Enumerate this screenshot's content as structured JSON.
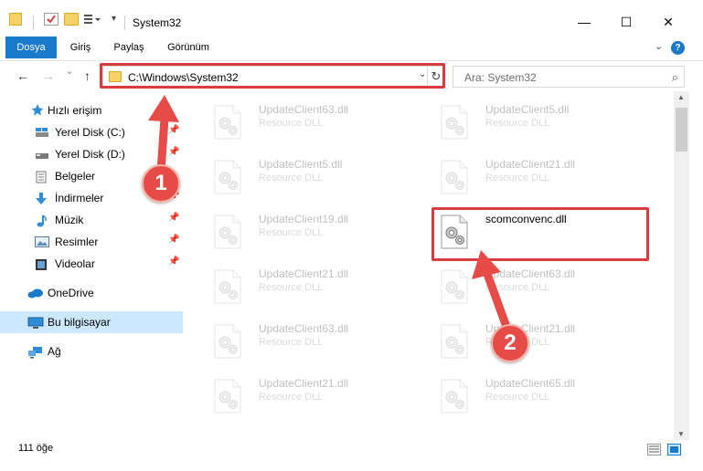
{
  "window": {
    "title": "System32",
    "minimize_symbol": "—",
    "maximize_symbol": "☐",
    "close_symbol": "✕"
  },
  "ribbon": {
    "tabs": [
      "Dosya",
      "Giriş",
      "Paylaş",
      "Görünüm"
    ],
    "expand_symbol": "⌄",
    "help_symbol": "?"
  },
  "navigation": {
    "back_symbol": "←",
    "forward_symbol": "→",
    "recent_symbol": "⌄",
    "up_symbol": "↑",
    "address": "C:\\Windows\\System32",
    "dropdown_symbol": "⌄",
    "refresh_symbol": "↻",
    "search_placeholder": "Ara: System32",
    "search_symbol": "⌕"
  },
  "sidebar": {
    "pin_symbol": "📌",
    "quick_access": {
      "label": "Hızlı erişim",
      "icon": "star-icon"
    },
    "items": [
      {
        "label": "Yerel Disk (C:)",
        "icon": "drive-icon",
        "pinned": true
      },
      {
        "label": "Yerel Disk (D:)",
        "icon": "drive-icon",
        "pinned": true
      },
      {
        "label": "Belgeler",
        "icon": "documents-icon",
        "pinned": true
      },
      {
        "label": "İndirmeler",
        "icon": "download-icon",
        "pinned": true
      },
      {
        "label": "Müzik",
        "icon": "music-icon",
        "pinned": true
      },
      {
        "label": "Resimler",
        "icon": "pictures-icon",
        "pinned": true
      },
      {
        "label": "Videolar",
        "icon": "videos-icon",
        "pinned": true
      }
    ],
    "onedrive": {
      "label": "OneDrive",
      "icon": "cloud-icon"
    },
    "this_pc": {
      "label": "Bu bilgisayar",
      "icon": "computer-icon",
      "selected": true
    },
    "network": {
      "label": "Ağ",
      "icon": "network-icon"
    }
  },
  "files": [
    {
      "name": "UpdateClient63.dll",
      "type": "Resource DLL",
      "faded": true
    },
    {
      "name": "UpdateClient5.dll",
      "type": "Resource DLL",
      "faded": true
    },
    {
      "name": "UpdateClient5.dll",
      "type": "Resource DLL",
      "faded": true
    },
    {
      "name": "UpdateClient21.dll",
      "type": "Resource DLL",
      "faded": true
    },
    {
      "name": "UpdateClient19.dll",
      "type": "Resource DLL",
      "faded": true
    },
    {
      "name": "scomconvenc.dll",
      "type": "",
      "faded": false
    },
    {
      "name": "UpdateClient21.dll",
      "type": "Resource DLL",
      "faded": true
    },
    {
      "name": "UpdateClient63.dll",
      "type": "Resource DLL",
      "faded": true
    },
    {
      "name": "UpdateClient63.dll",
      "type": "Resource DLL",
      "faded": true
    },
    {
      "name": "UpdateClient21.dll",
      "type": "Resource DLL",
      "faded": true
    },
    {
      "name": "UpdateClient21.dll",
      "type": "Resource DLL",
      "faded": true
    },
    {
      "name": "UpdateClient65.dll",
      "type": "Resource DLL",
      "faded": true
    }
  ],
  "status": {
    "item_count": "111 öğe"
  },
  "scrollbar": {
    "up_symbol": "▲",
    "down_symbol": "▼"
  },
  "annotations": {
    "step1": "1",
    "step2": "2",
    "color": "#e64b48"
  }
}
